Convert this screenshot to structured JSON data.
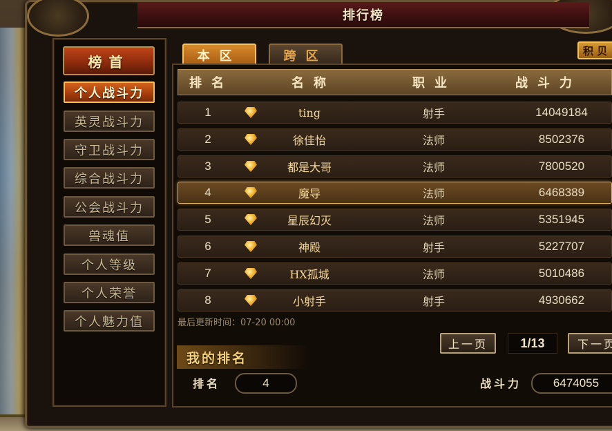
{
  "window": {
    "title": "排行榜"
  },
  "sidebar": {
    "header": "榜首",
    "items": [
      {
        "label": "个人战斗力",
        "active": true
      },
      {
        "label": "英灵战斗力",
        "active": false
      },
      {
        "label": "守卫战斗力",
        "active": false
      },
      {
        "label": "综合战斗力",
        "active": false
      },
      {
        "label": "公会战斗力",
        "active": false
      },
      {
        "label": "兽魂值",
        "active": false
      },
      {
        "label": "个人等级",
        "active": false
      },
      {
        "label": "个人荣誉",
        "active": false
      },
      {
        "label": "个人魅力值",
        "active": false
      }
    ]
  },
  "tabs": [
    {
      "label": "本区",
      "active": true
    },
    {
      "label": "跨区",
      "active": false
    }
  ],
  "points_button": {
    "label": "积 贝"
  },
  "table": {
    "headers": {
      "rank": "排名",
      "name": "名称",
      "job": "职业",
      "power": "战斗力"
    },
    "rows": [
      {
        "rank": "1",
        "name": "ting",
        "job": "射手",
        "power": "14049184",
        "highlight": false
      },
      {
        "rank": "2",
        "name": "徐佳怡",
        "job": "法师",
        "power": "8502376",
        "highlight": false
      },
      {
        "rank": "3",
        "name": "都是大哥",
        "job": "法师",
        "power": "7800520",
        "highlight": false
      },
      {
        "rank": "4",
        "name": "魔导",
        "job": "法师",
        "power": "6468389",
        "highlight": true
      },
      {
        "rank": "5",
        "name": "星辰幻灭",
        "job": "法师",
        "power": "5351945",
        "highlight": false
      },
      {
        "rank": "6",
        "name": "神殿",
        "job": "射手",
        "power": "5227707",
        "highlight": false
      },
      {
        "rank": "7",
        "name": "HX孤城",
        "job": "法师",
        "power": "5010486",
        "highlight": false
      },
      {
        "rank": "8",
        "name": "小射手",
        "job": "射手",
        "power": "4930662",
        "highlight": false
      }
    ]
  },
  "last_update": "最后更新时间：07-20 00:00",
  "pagination": {
    "prev_label": "上一页",
    "next_label": "下一页",
    "current": "1/13"
  },
  "my_rank": {
    "title": "我的排名",
    "rank_label": "排名",
    "rank_value": "4",
    "power_label": "战斗力",
    "power_value": "6474055"
  },
  "colors": {
    "accent": "#d2631c",
    "title_bar": "#5a1a1a",
    "highlight_border": "#e2b060"
  }
}
